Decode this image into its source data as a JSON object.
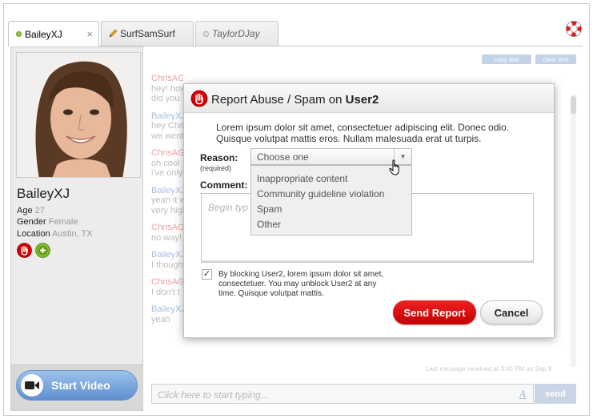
{
  "tabs": [
    {
      "label": "BaileyXJ",
      "close": "×"
    },
    {
      "label": "SurfSamSurf"
    },
    {
      "label": "TaylorDJay"
    }
  ],
  "profile": {
    "name": "BaileyXJ",
    "age_label": "Age",
    "age": "27",
    "gender_label": "Gender",
    "gender": "Female",
    "location_label": "Location",
    "location": "Austin, TX"
  },
  "video": {
    "start_label": "Start Video"
  },
  "chat": {
    "copy_text": "copy text",
    "clear_text": "clear text",
    "messages": [
      {
        "name": "ChrisAGill",
        "text": "hey! how",
        "text2": "did you"
      },
      {
        "name": "BaileyXJ",
        "text": "hey Chris",
        "text2": "we went"
      },
      {
        "name": "ChrisAGill",
        "text": "oh cool",
        "text2": "i've only"
      },
      {
        "name": "BaileyXJ",
        "text": "yeah it w",
        "text2": "very high"
      },
      {
        "name": "ChrisAGill",
        "text": "no way!"
      },
      {
        "name": "BaileyXJ",
        "text": "I though"
      },
      {
        "name": "ChrisAGill",
        "text": "I don't t"
      },
      {
        "name": "BaileyXJ",
        "text": "yeah"
      }
    ],
    "last_message": "Last message received at 3:45 PM on Sep 8",
    "placeholder": "Click here to start typing...",
    "font_button": "A",
    "send_label": "send"
  },
  "modal": {
    "title_prefix": "Report Abuse / Spam on ",
    "title_user": "User2",
    "description": "Lorem ipsum dolor sit amet, consectetuer adipiscing elit. Donec odio. Quisque volutpat mattis eros. Nullam malesuada erat ut turpis.",
    "reason_label": "Reason:",
    "required_label": "(required)",
    "select_value": "Choose one",
    "options": [
      "Inappropriate content",
      "Community guideline violation",
      "Spam",
      "Other"
    ],
    "comment_label": "Comment:",
    "comment_placeholder": "Begin typ",
    "checkbox_mark": "✓",
    "block_text": "By blocking User2, lorem ipsum dolor sit amet, consectetuer. You may unblock User2 at any time. Quisque volutpat mattis.",
    "send_report": "Send Report",
    "cancel": "Cancel"
  },
  "colors": {
    "accent_red": "#d40000",
    "video_blue": "#6f9bd8",
    "online_green": "#8cc63e"
  }
}
